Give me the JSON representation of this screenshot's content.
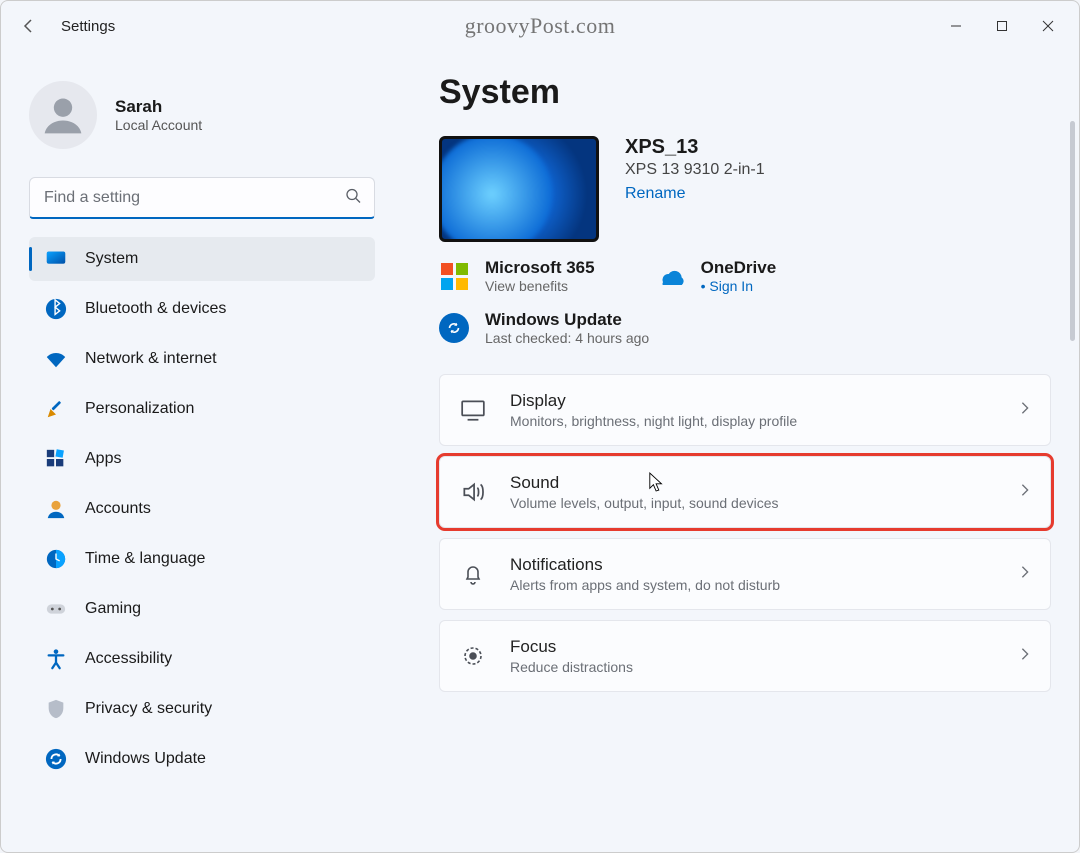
{
  "titlebar": {
    "app_title": "Settings",
    "watermark": "groovyPost.com"
  },
  "profile": {
    "name": "Sarah",
    "subtitle": "Local Account"
  },
  "search": {
    "placeholder": "Find a setting"
  },
  "sidebar": {
    "items": {
      "system": "System",
      "bluetooth": "Bluetooth & devices",
      "network": "Network & internet",
      "personalization": "Personalization",
      "apps": "Apps",
      "accounts": "Accounts",
      "time": "Time & language",
      "gaming": "Gaming",
      "accessibility": "Accessibility",
      "privacy": "Privacy & security",
      "update": "Windows Update"
    }
  },
  "page": {
    "title": "System",
    "device": {
      "name": "XPS_13",
      "model": "XPS 13 9310 2-in-1",
      "rename": "Rename"
    },
    "services": {
      "m365_title": "Microsoft 365",
      "m365_sub": "View benefits",
      "onedrive_title": "OneDrive",
      "onedrive_sub": "Sign In"
    },
    "update": {
      "title": "Windows Update",
      "sub": "Last checked: 4 hours ago"
    },
    "cards": {
      "display": {
        "title": "Display",
        "sub": "Monitors, brightness, night light, display profile"
      },
      "sound": {
        "title": "Sound",
        "sub": "Volume levels, output, input, sound devices"
      },
      "notifications": {
        "title": "Notifications",
        "sub": "Alerts from apps and system, do not disturb"
      },
      "focus": {
        "title": "Focus",
        "sub": "Reduce distractions"
      }
    }
  }
}
